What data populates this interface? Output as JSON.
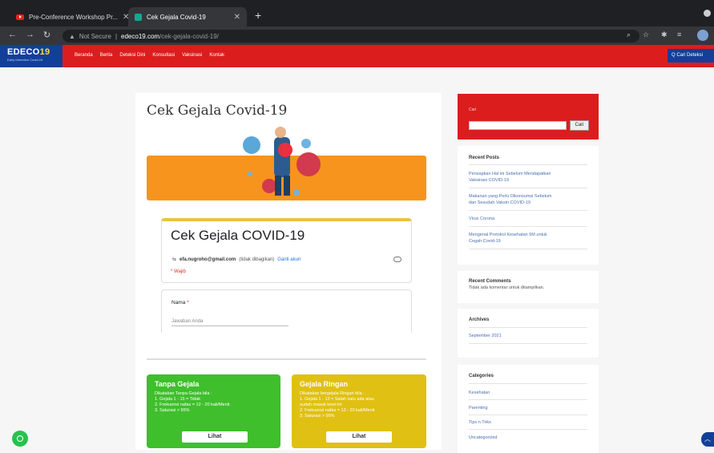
{
  "browser": {
    "tabs": [
      {
        "label": "Pre-Conference Workshop Pr...",
        "icon": "youtube-icon"
      },
      {
        "label": "Cek Gejala Covid-19",
        "icon": "site-favicon-icon",
        "active": true
      }
    ],
    "address": {
      "security": "Not Secure",
      "separator": "|",
      "domain": "edeco19.com",
      "path": "/cek-gejala-covid-19/"
    }
  },
  "site": {
    "logo": {
      "text_a": "EDECO",
      "text_b": "19",
      "tagline": "Early Detection Covid-19"
    },
    "nav": [
      "Beranda",
      "Berita",
      "Deteksi Dini",
      "Konsultasi",
      "Vaksinasi",
      "Kontak"
    ],
    "search_button": "Q Cari Deteksi"
  },
  "main": {
    "title": "Cek Gejala Covid-19",
    "form": {
      "title": "Cek Gejala COVID-19",
      "email": "efa.nugroho@gmail.com",
      "email_note": "(tidak dibagikan)",
      "switch_account": "Ganti akun",
      "required_note": "* Wajib",
      "question_label": "Nama",
      "question_required": "*",
      "question_placeholder": "Jawaban Anda"
    },
    "boxes": [
      {
        "title": "Tanpa Gejala",
        "lines": [
          "Dikatakan Tanpa Gejala bila :",
          "1. Gejala 1 - 15 = Tidak",
          "2. Frekuensi nafas = 12 - 20 kali/Menit",
          "3. Saturasi > 95%"
        ],
        "button": "Lihat",
        "color": "#3fbf2c"
      },
      {
        "title": "Gejala Ringan",
        "lines": [
          "Dikatakan bergejala Ringan bila :",
          "1. Gejala 1 - 13 = Salah satu ada atau",
          "sudah masuk level ini",
          "2. Frekuensi nafas = 12 - 20 kali/Menit",
          "3. Saturasi > 95%"
        ],
        "button": "Lihat",
        "color": "#e0c012"
      }
    ]
  },
  "sidebar": {
    "search_label": "Cari",
    "search_button": "Cari",
    "recent_posts": {
      "title": "Recent Posts",
      "items": [
        [
          "Persiapkan Hal ini Sebelum Mendapatkan",
          "Vaksinasi COVID-19"
        ],
        [
          "Makanan yang Perlu Dikonsumsi Sebelum",
          "dan Sesudah Vaksin COVID-19"
        ],
        [
          "Virus Corona"
        ],
        [
          "Mengenal Protokol Kesehatan 5M untuk",
          "Cegah Covid-19"
        ]
      ]
    },
    "recent_comments": {
      "title": "Recent Comments",
      "text": "Tidak ada komentar untuk ditampilkan."
    },
    "archives": {
      "title": "Archives",
      "items": [
        "September 2021"
      ]
    },
    "categories": {
      "title": "Categories",
      "items": [
        "Kesehatan",
        "Parenting",
        "Tips n Triks",
        "Uncategorized"
      ]
    }
  }
}
